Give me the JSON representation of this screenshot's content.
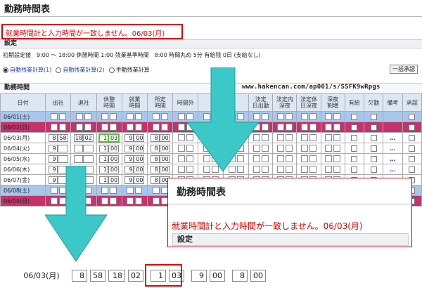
{
  "page": {
    "title": "勤務時間表",
    "error_message": "就業時間計と入力時間が一致しません。06/03(月)"
  },
  "settings": {
    "header": "設定",
    "summary": "初期設定値　9:00 ～ 18:00 休憩時間 1:00 残業基準時間　8:00 時間丸め 5分 有給残 0日 (支給なし)",
    "radios": [
      {
        "label": "自動残業計算(1)",
        "selected": true
      },
      {
        "label": "自動残業計算(2)",
        "selected": false
      },
      {
        "label": "手動残業計算",
        "selected": false
      }
    ],
    "bulk_button": "一括承認"
  },
  "worktime": {
    "header": "勤務時間",
    "url": "www.hakencan.com/ap001/s/SSFK9wRpgs",
    "columns": [
      "日付",
      "出社",
      "退社",
      "休憩\n時間",
      "就業\n時間",
      "所定\n時間",
      "時間外",
      "",
      "",
      "法定\n日出勤",
      "法定内\n深夜",
      "法定休\n日深夜",
      "深夜\n割増",
      "有給",
      "欠勤",
      "備考",
      "承認"
    ],
    "rows": [
      {
        "date": "06/01(土)",
        "type": "sat",
        "in_h": "",
        "in_m": "",
        "out_h": "",
        "out_m": "",
        "br_h": "",
        "br_m": "",
        "wk_h": "",
        "wk_m": "",
        "sc_h": "",
        "sc_m": "",
        "note": ""
      },
      {
        "date": "06/02(日)",
        "type": "sun",
        "in_h": "",
        "in_m": "",
        "out_h": "",
        "out_m": "",
        "br_h": "",
        "br_m": "",
        "wk_h": "",
        "wk_m": "",
        "sc_h": "",
        "sc_m": "",
        "note": ""
      },
      {
        "date": "06/03(月)",
        "type": "norm",
        "in_h": "8",
        "in_m": "58",
        "out_h": "18",
        "out_m": "02",
        "br_h": "1",
        "br_m": "03",
        "wk_h": "9",
        "wk_m": "00",
        "sc_h": "8",
        "sc_m": "00",
        "note": "…",
        "highlight": true
      },
      {
        "date": "06/04(火)",
        "type": "norm",
        "in_h": "9",
        "in_m": "",
        "out_h": "",
        "out_m": "",
        "br_h": "1",
        "br_m": "00",
        "wk_h": "9",
        "wk_m": "00",
        "sc_h": "8",
        "sc_m": "00",
        "note": "…"
      },
      {
        "date": "06/05(水)",
        "type": "norm",
        "in_h": "9",
        "in_m": "",
        "out_h": "",
        "out_m": "",
        "br_h": "1",
        "br_m": "00",
        "wk_h": "9",
        "wk_m": "00",
        "sc_h": "8",
        "sc_m": "00",
        "note": "…"
      },
      {
        "date": "06/06(木)",
        "type": "norm",
        "in_h": "9",
        "in_m": "",
        "out_h": "",
        "out_m": "",
        "br_h": "1",
        "br_m": "00",
        "wk_h": "9",
        "wk_m": "00",
        "sc_h": "8",
        "sc_m": "00",
        "note": "…"
      },
      {
        "date": "06/07(金)",
        "type": "norm",
        "in_h": "9",
        "in_m": "",
        "out_h": "",
        "out_m": "",
        "br_h": "1",
        "br_m": "00",
        "wk_h": "9",
        "wk_m": "00",
        "sc_h": "8",
        "sc_m": "00",
        "note": "…"
      },
      {
        "date": "06/08(土)",
        "type": "sat",
        "in_h": "",
        "in_m": "",
        "out_h": "",
        "out_m": "",
        "br_h": "",
        "br_m": "",
        "wk_h": "",
        "wk_m": "",
        "sc_h": "",
        "sc_m": "",
        "note": ""
      },
      {
        "date": "06/09(日)",
        "type": "sun",
        "in_h": "",
        "in_m": "",
        "out_h": "",
        "out_m": "",
        "br_h": "",
        "br_m": "",
        "wk_h": "",
        "wk_m": "",
        "sc_h": "",
        "sc_m": "",
        "note": ""
      }
    ]
  },
  "zoom_callout": {
    "title": "勤務時間表",
    "error_message": "就業時間計と入力時間が一致しません。06/03(月)",
    "settings_header": "設定"
  },
  "zoom_row": {
    "date": "06/03(月)",
    "in_h": "8",
    "in_m": "58",
    "out_h": "18",
    "out_m": "02",
    "br_h": "1",
    "br_m": "03",
    "wk_h": "9",
    "wk_m": "00",
    "sc_h": "8",
    "sc_m": "00"
  },
  "colors": {
    "arrow": "#3cc8c8",
    "error": "#e00000",
    "sat": "#a8c7ec",
    "sun": "#c4336a"
  }
}
